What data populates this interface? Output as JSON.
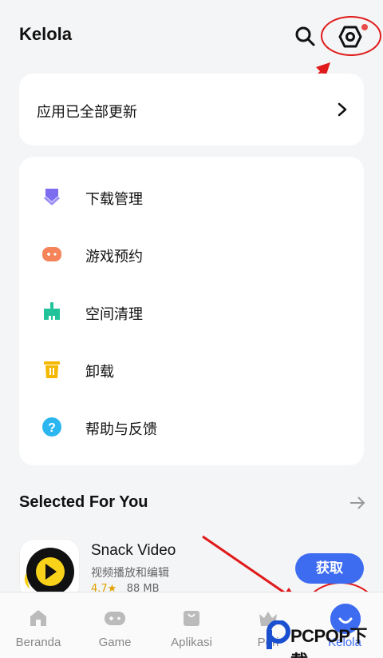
{
  "header": {
    "title": "Kelola",
    "search_icon": "search-icon",
    "settings_icon": "settings-hexagon-icon",
    "notification_dot_color": "#e94b4b"
  },
  "update_card": {
    "text": "应用已全部更新"
  },
  "menu": {
    "items": [
      {
        "label": "下载管理",
        "icon": "download-icon",
        "color": "#7b6cf0"
      },
      {
        "label": "游戏预约",
        "icon": "gamepad-icon",
        "color": "#f5845a"
      },
      {
        "label": "空间清理",
        "icon": "broom-icon",
        "color": "#22c39a"
      },
      {
        "label": "卸载",
        "icon": "trash-icon",
        "color": "#f5b800"
      },
      {
        "label": "帮助与反馈",
        "icon": "help-icon",
        "color": "#2bb6f0"
      }
    ]
  },
  "recommend": {
    "title": "Selected For You",
    "app": {
      "name": "Snack Video",
      "desc": "视频播放和编辑",
      "rating": "4.7★",
      "size": "88 MB",
      "button": "获取"
    }
  },
  "bottom_nav": {
    "items": [
      {
        "label": "Beranda",
        "icon": "home-icon"
      },
      {
        "label": "Game",
        "icon": "gamepad-icon"
      },
      {
        "label": "Aplikasi",
        "icon": "bag-icon"
      },
      {
        "label": "Peri",
        "icon": "crown-icon"
      },
      {
        "label": "Kelola",
        "icon": "smiley-icon"
      }
    ],
    "accent": "#3d6cf1"
  },
  "watermark": {
    "text": "PCPOP下载"
  }
}
